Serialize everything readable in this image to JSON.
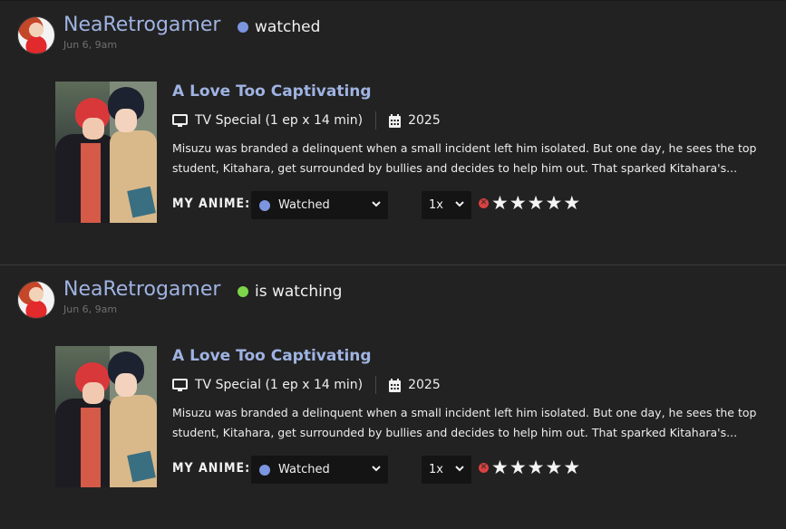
{
  "entries": [
    {
      "user": "NeaRetrogamer",
      "status_text": "watched",
      "status_color": "#7b95e0",
      "time": "Jun 6, 9am",
      "anime_title": "A Love Too Captivating",
      "type": "TV Special (1 ep x 14 min)",
      "year": "2025",
      "description": "Misuzu was branded a delinquent when a small incident left him isolated. But one day, he sees the top student, Kitahara, get surrounded by bullies and decides to help him out. That sparked Kitahara's...",
      "my_anime_label": "MY ANIME:",
      "list_status": "Watched",
      "list_status_color": "#7b95e0",
      "rewatch": "1x",
      "stars": [
        "★",
        "★",
        "★",
        "★",
        "★"
      ]
    },
    {
      "user": "NeaRetrogamer",
      "status_text": "is watching",
      "status_color": "#7cd64b",
      "time": "Jun 6, 9am",
      "anime_title": "A Love Too Captivating",
      "type": "TV Special (1 ep x 14 min)",
      "year": "2025",
      "description": "Misuzu was branded a delinquent when a small incident left him isolated. But one day, he sees the top student, Kitahara, get surrounded by bullies and decides to help him out. That sparked Kitahara's...",
      "my_anime_label": "MY ANIME:",
      "list_status": "Watched",
      "list_status_color": "#7b95e0",
      "rewatch": "1x",
      "stars": [
        "★",
        "★",
        "★",
        "★",
        "★"
      ]
    }
  ]
}
